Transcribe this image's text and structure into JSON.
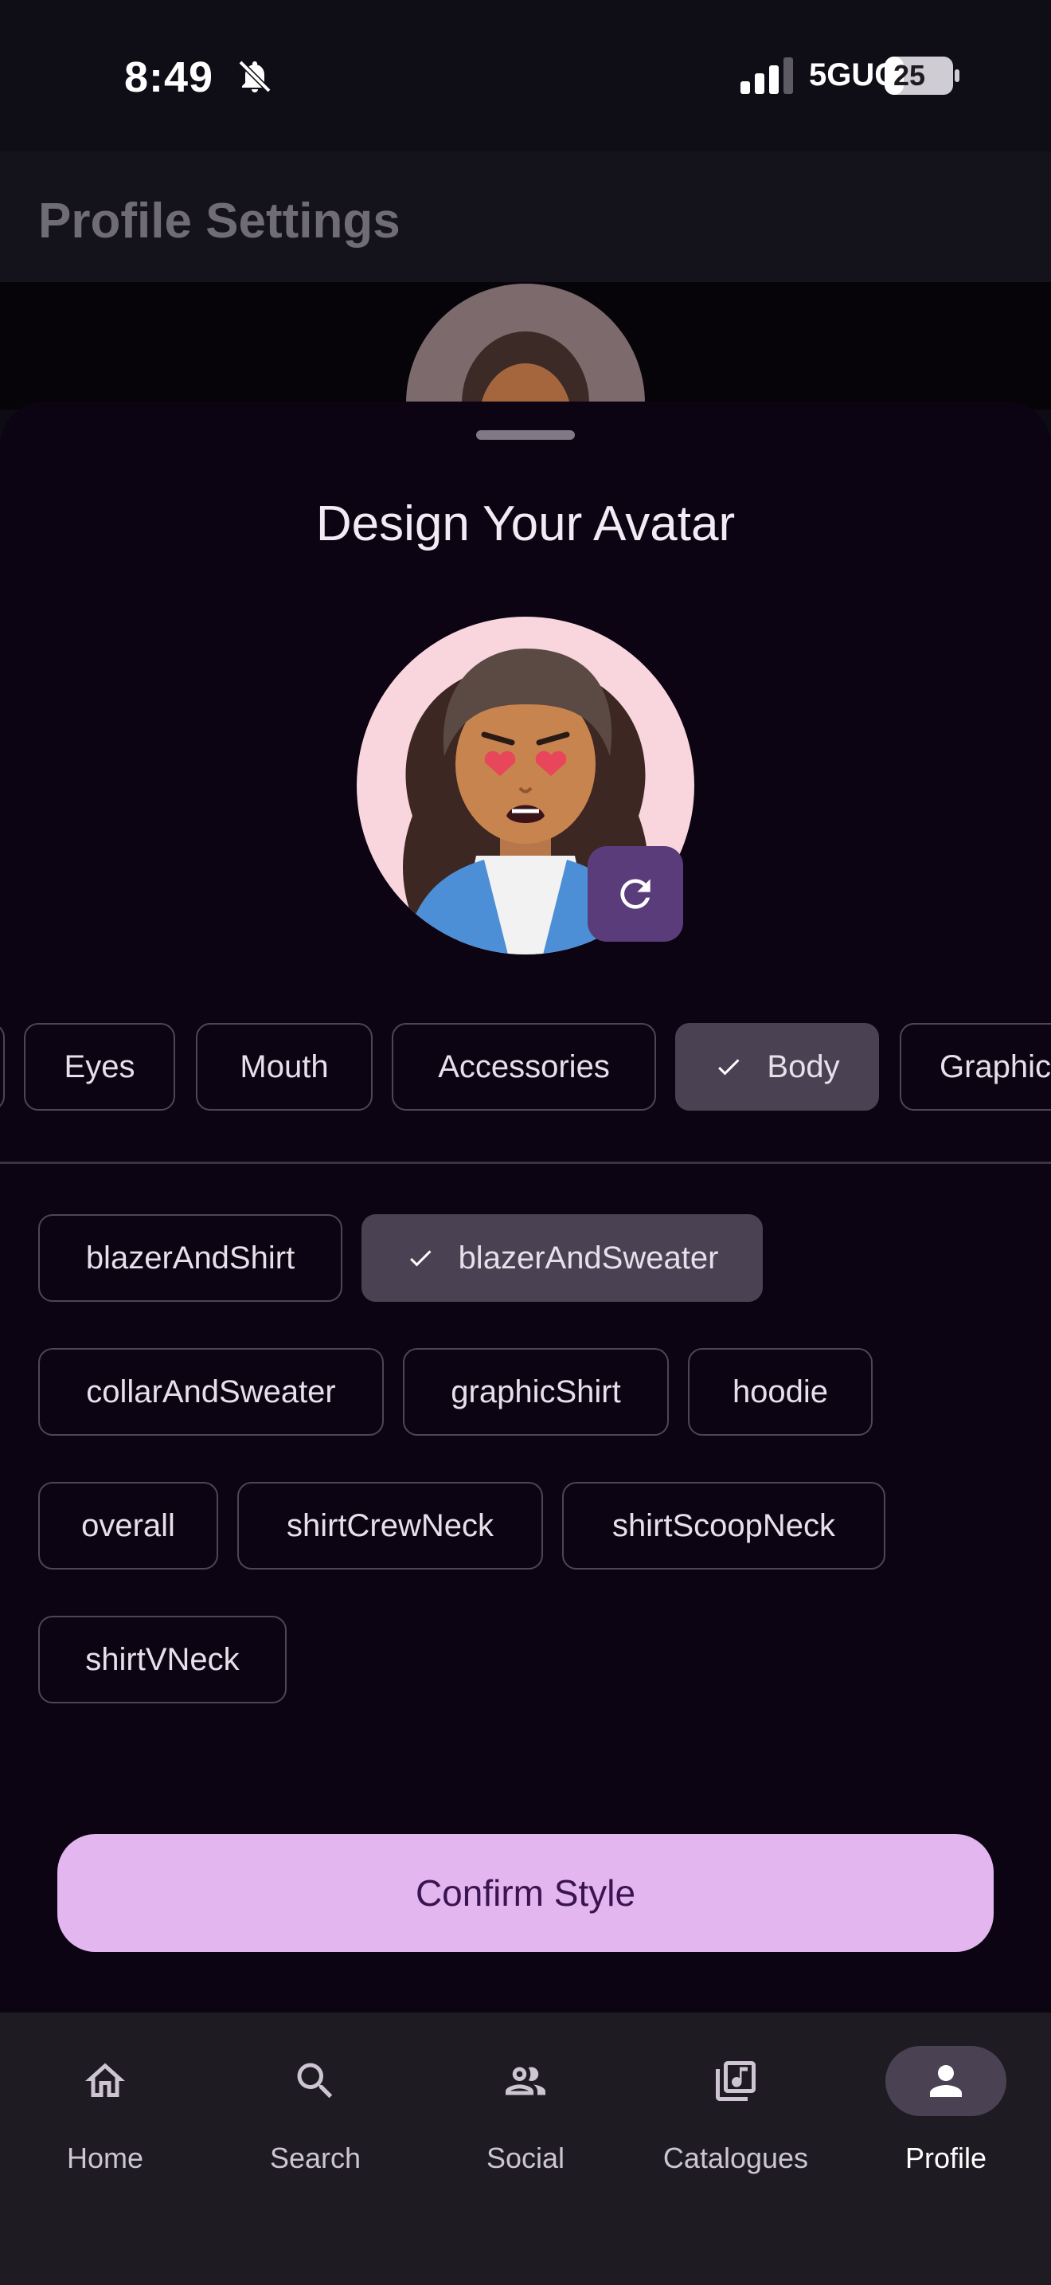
{
  "status_bar": {
    "time": "8:49",
    "network": "5GUC",
    "battery": "25",
    "icons": [
      "bell-off-icon",
      "signal-icon",
      "battery-icon"
    ]
  },
  "app_bar": {
    "title": "Profile Settings"
  },
  "sheet": {
    "title": "Design Your Avatar",
    "refresh_icon": "refresh-icon",
    "categories": [
      {
        "label": "Eyes",
        "selected": false
      },
      {
        "label": "Mouth",
        "selected": false
      },
      {
        "label": "Accessories",
        "selected": false
      },
      {
        "label": "Body",
        "selected": true
      },
      {
        "label": "Graphic",
        "selected": false
      }
    ],
    "options": [
      {
        "label": "blazerAndShirt",
        "selected": false
      },
      {
        "label": "blazerAndSweater",
        "selected": true
      },
      {
        "label": "collarAndSweater",
        "selected": false
      },
      {
        "label": "graphicShirt",
        "selected": false
      },
      {
        "label": "hoodie",
        "selected": false
      },
      {
        "label": "overall",
        "selected": false
      },
      {
        "label": "shirtCrewNeck",
        "selected": false
      },
      {
        "label": "shirtScoopNeck",
        "selected": false
      },
      {
        "label": "shirtVNeck",
        "selected": false
      }
    ],
    "confirm_label": "Confirm Style"
  },
  "nav": {
    "items": [
      {
        "label": "Home",
        "icon": "home-icon"
      },
      {
        "label": "Search",
        "icon": "search-icon"
      },
      {
        "label": "Social",
        "icon": "people-icon"
      },
      {
        "label": "Catalogues",
        "icon": "library-music-icon"
      },
      {
        "label": "Profile",
        "icon": "person-icon",
        "active": true
      }
    ]
  },
  "colors": {
    "accent": "#e3b6f0",
    "selected_chip": "#4a4252",
    "sheet_bg": "#0c0413",
    "refresh_button": "#5a3c7a"
  }
}
